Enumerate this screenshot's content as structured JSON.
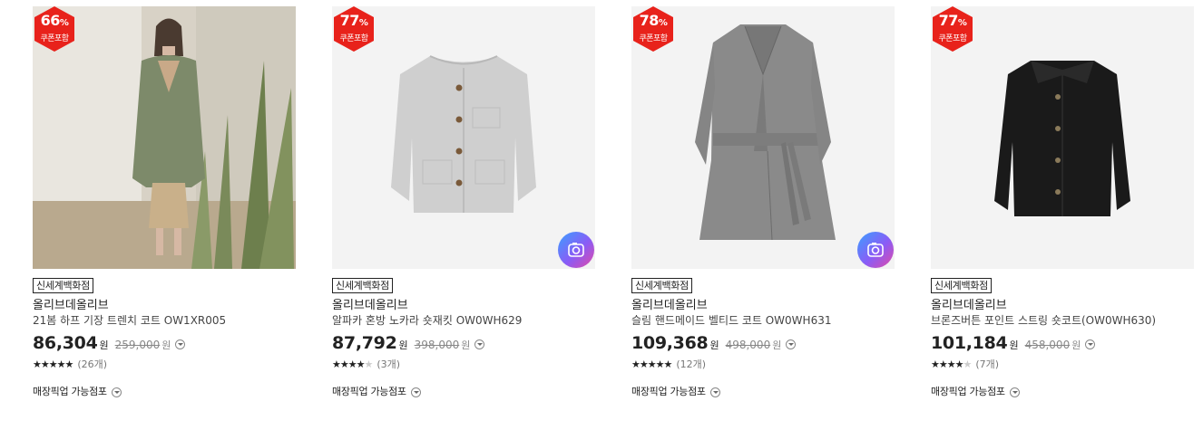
{
  "products": [
    {
      "discount": "66",
      "percent_sign": "%",
      "coupon_label": "쿠폰포함",
      "store_tag": "신세계백화점",
      "brand": "올리브데올리브",
      "name": "21봄 하프 기장 트렌치 코트 OW1XR005",
      "price": "86,304",
      "won": "원",
      "original_price": "259,000",
      "stars": "★★★★★",
      "stars_empty": "",
      "review_count": "(26개)",
      "pickup": "매장픽업 가능점포",
      "has_camera": false,
      "image": "model-trench-coat"
    },
    {
      "discount": "77",
      "percent_sign": "%",
      "coupon_label": "쿠폰포함",
      "store_tag": "신세계백화점",
      "brand": "올리브데올리브",
      "name": "알파카 혼방 노카라 숏재킷 OW0WH629",
      "price": "87,792",
      "won": "원",
      "original_price": "398,000",
      "stars": "★★★★",
      "stars_empty": "★",
      "review_count": "(3개)",
      "pickup": "매장픽업 가능점포",
      "has_camera": true,
      "image": "light-gray-jacket"
    },
    {
      "discount": "78",
      "percent_sign": "%",
      "coupon_label": "쿠폰포함",
      "store_tag": "신세계백화점",
      "brand": "올리브데올리브",
      "name": "슬림 핸드메이드 벨티드 코트 OW0WH631",
      "price": "109,368",
      "won": "원",
      "original_price": "498,000",
      "stars": "★★★★★",
      "stars_empty": "",
      "review_count": "(12개)",
      "pickup": "매장픽업 가능점포",
      "has_camera": true,
      "image": "gray-belted-coat"
    },
    {
      "discount": "77",
      "percent_sign": "%",
      "coupon_label": "쿠폰포함",
      "store_tag": "신세계백화점",
      "brand": "올리브데올리브",
      "name": "브론즈버튼 포인트 스트링 숏코트(OW0WH630)",
      "price": "101,184",
      "won": "원",
      "original_price": "458,000",
      "stars": "★★★★",
      "stars_empty": "★",
      "review_count": "(7개)",
      "pickup": "매장픽업 가능점포",
      "has_camera": false,
      "image": "black-short-coat"
    }
  ],
  "colors": {
    "badge_red": "#e8221b",
    "camera_gradient": [
      "#3aa0ff",
      "#8a5cf6",
      "#e14aa8"
    ]
  }
}
